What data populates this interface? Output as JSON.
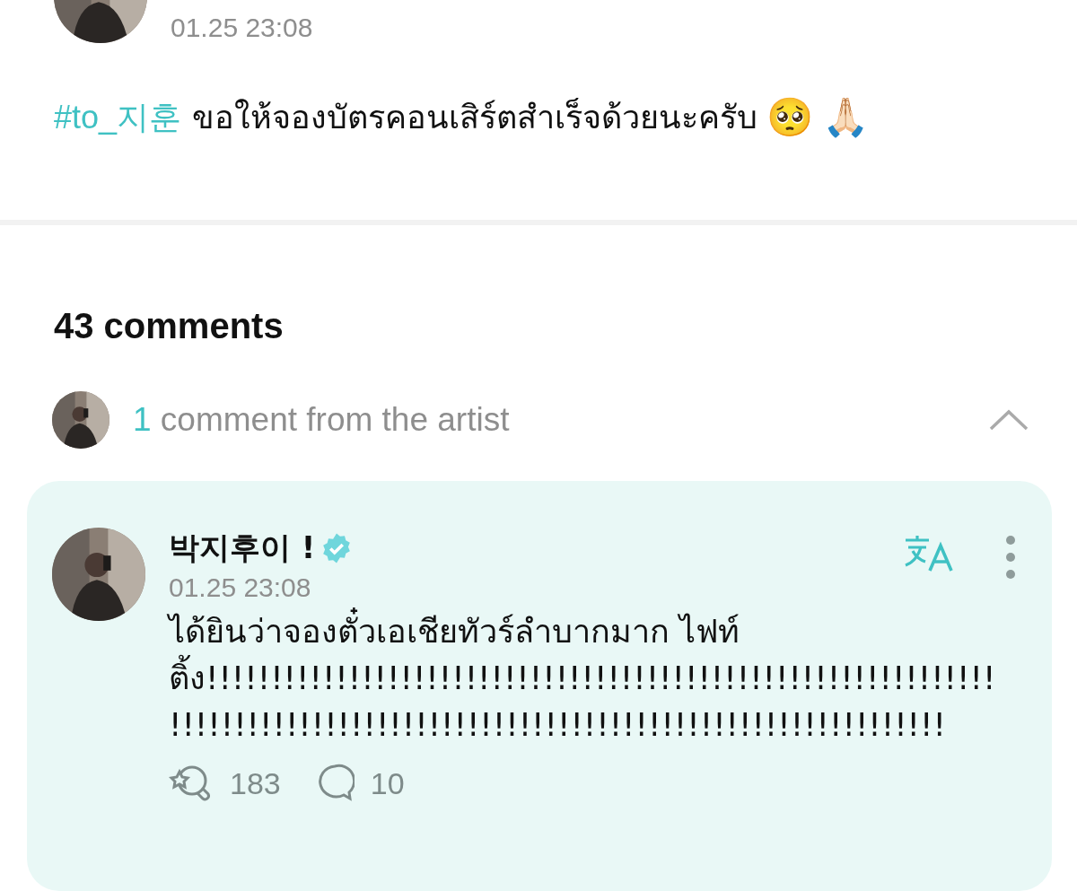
{
  "post": {
    "time": "01.25 23:08",
    "hashtag": "#to_지훈",
    "text": "ขอให้จองบัตรคอนเสิร์ตสำเร็จด้วยนะครับ",
    "emojis": [
      "🥺",
      "🙏🏻"
    ]
  },
  "comments": {
    "heading": "43 comments",
    "artist_summary": {
      "count": "1",
      "label": "comment from the artist",
      "expanded": true
    },
    "artist_comments": [
      {
        "author": "박지후이 !",
        "verified": true,
        "time": "01.25 23:08",
        "text": "ได้ยินว่าจองตั๋วเอเชียทัวร์ลำบากมาก ไฟท์ติ้ง!!!!!!!!!!!!!!!!!!!!!!!!!!!!!!!!!!!!!!!!!!!!!!!!!!!!!!!!!!!!!!!!!!!!!!!!!!!!!!!!!!!!!!!!!!!!!!!!!!!!!!!!!!!!!!!!!!!!!!!!!",
        "likes": "183",
        "replies": "10"
      }
    ]
  }
}
